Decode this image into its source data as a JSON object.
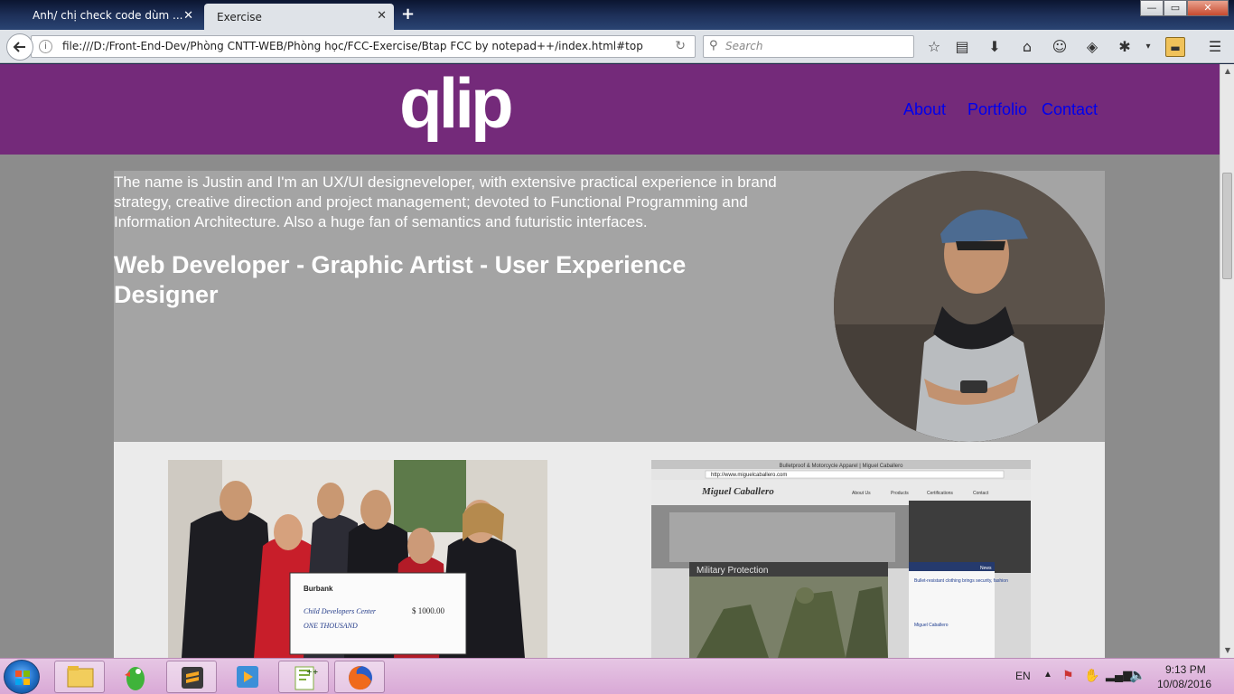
{
  "browser": {
    "tabs": [
      {
        "label": "Anh/ chị check code dùm ...",
        "active": false
      },
      {
        "label": "Exercise",
        "active": true
      }
    ],
    "url": "file:///D:/Front-End-Dev/Phòng CNTT-WEB/Phòng học/FCC-Exercise/Btap FCC by notepad++/index.html#top",
    "search_placeholder": "Search"
  },
  "site": {
    "logo": "qlip",
    "nav": [
      "About",
      "Portfolio",
      "Contact"
    ],
    "intro": "The name is Justin and I'm an UX/UI designeveloper, with extensive practical experience in brand strategy, creative direction and project management; devoted to Functional Programming and Information Architecture. Also a huge fan of semantics and futuristic interfaces.",
    "headline": "Web Developer - Graphic Artist - User Experience Designer"
  },
  "thumb_right": {
    "window_title": "Bulletproof & Motorcycle Apparel | Miguel Caballero",
    "address": "http://www.miguelcaballero.com",
    "brand": "Miguel Caballero",
    "nav": [
      "About Us",
      "Products",
      "Certifications",
      "Contact"
    ],
    "banner": "Military Protection",
    "news_label": "News",
    "news1_title": "Bullet-resistant clothing brings security, fashion",
    "news2_title": "Miguel Caballero"
  },
  "thumb_left": {
    "check_amount": "$ 1000.00",
    "check_words": "ONE THOUSAND",
    "check_payee": "Child Developers Center",
    "bank": "Burbank"
  },
  "taskbar": {
    "lang": "EN",
    "time": "9:13 PM",
    "date": "10/08/2016"
  },
  "colors": {
    "header_purple": "#742a7a",
    "nav_link": "#0000ee",
    "intro_bg": "#a4a4a4",
    "page_bg": "#8c8c8c"
  }
}
